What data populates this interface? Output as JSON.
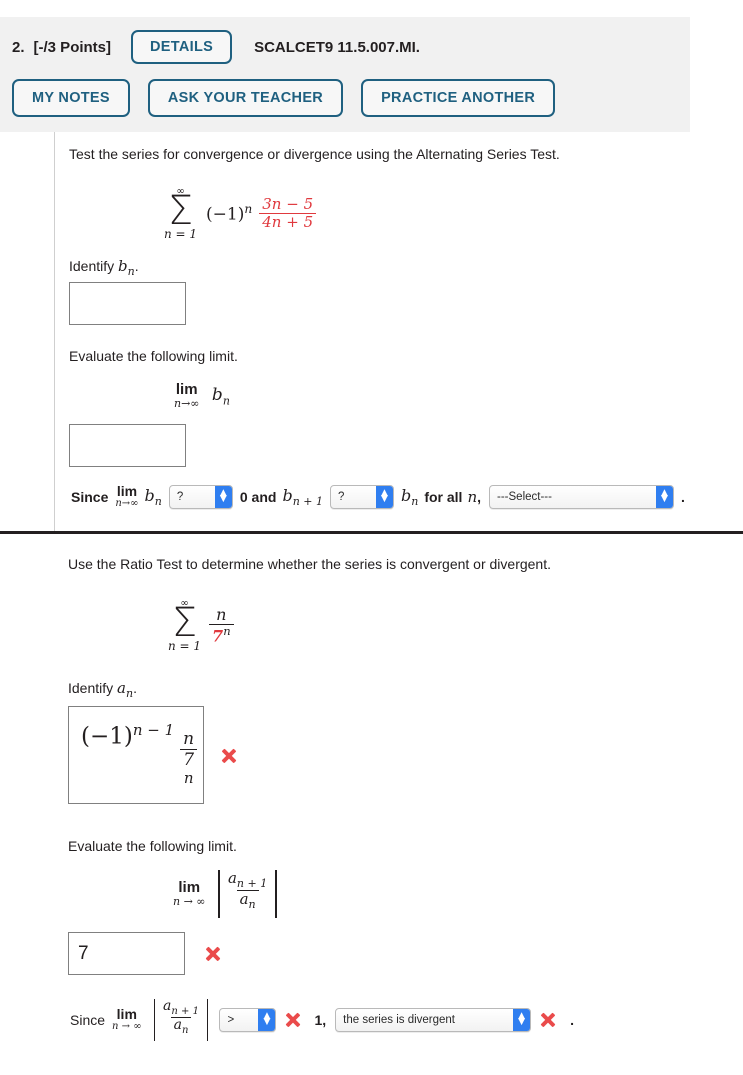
{
  "header": {
    "question_number": "2.",
    "points": "[-/3 Points]",
    "details_label": "DETAILS",
    "assignment_code": "SCALCET9 11.5.007.MI.",
    "buttons": [
      {
        "label": "MY NOTES"
      },
      {
        "label": "ASK YOUR TEACHER"
      },
      {
        "label": "PRACTICE ANOTHER"
      }
    ],
    "panel_bg": "#f1f1f1",
    "accent": "#1f6080"
  },
  "part_a": {
    "prompt": "Test the series for convergence or divergence using the Alternating Series Test.",
    "series": {
      "sigma_top": "∞",
      "sigma_bottom": "n = 1",
      "factor": "(−1)",
      "factor_exp": "n",
      "numerator": "3n − 5",
      "denominator": "4n + 5",
      "fraction_color": "#e0393e"
    },
    "identify_label_pre": "Identify ",
    "identify_symbol": "b",
    "identify_symbol_sub": "n",
    "identify_label_post": ".",
    "answer1_value": "",
    "evaluate_label": "Evaluate the following limit.",
    "limit": {
      "op": "lim",
      "under": "n→∞",
      "expr": "b",
      "expr_sub": "n"
    },
    "answer2_value": "",
    "since": {
      "since_word": "Since",
      "lim_op": "lim",
      "lim_under": "n→∞",
      "b_symbol": "b",
      "b_sub": "n",
      "select1_value": "?",
      "mid_text": "0 and",
      "b2_symbol": "b",
      "b2_sub": "n + 1",
      "select2_value": "?",
      "b3_symbol": "b",
      "b3_sub": "n",
      "tail_text": "for all",
      "n_symbol": "n",
      "comma": ",",
      "select3_value": "---Select---",
      "period": "."
    }
  },
  "part_b": {
    "prompt": "Use the Ratio Test to determine whether the series is convergent or divergent.",
    "series": {
      "sigma_top": "∞",
      "sigma_bottom": "n = 1",
      "numerator": "n",
      "denominator_base": "7",
      "denominator_exp": "n",
      "denominator_color": "#e0393e"
    },
    "identify_label_pre": "Identify ",
    "identify_symbol": "a",
    "identify_symbol_sub": "n",
    "identify_label_post": ".",
    "answer_math": {
      "factor": "(−1)",
      "factor_exp": "n − 1",
      "frac_num": "n",
      "frac_den": "7",
      "frac_sub": "n"
    },
    "answer_math_status": "incorrect",
    "evaluate_label": "Evaluate the following limit.",
    "limit": {
      "op": "lim",
      "under": "n → ∞",
      "num": "a",
      "num_sub": "n + 1",
      "den": "a",
      "den_sub": "n"
    },
    "answer_value": "7",
    "answer_status": "incorrect",
    "since": {
      "since_word": "Since",
      "lim_op": "lim",
      "lim_under": "n → ∞",
      "num": "a",
      "num_sub": "n + 1",
      "den": "a",
      "den_sub": "n",
      "select_op_value": ">",
      "op_status": "incorrect",
      "one_text": "1,",
      "select_statement_value": "the series is divergent",
      "statement_status": "incorrect",
      "period": "."
    }
  },
  "colors": {
    "red_math": "#e0393e",
    "x_mark": "#ea4b4b",
    "link_blue": "#1f6080",
    "select_arrow": "#2f7ef0"
  }
}
